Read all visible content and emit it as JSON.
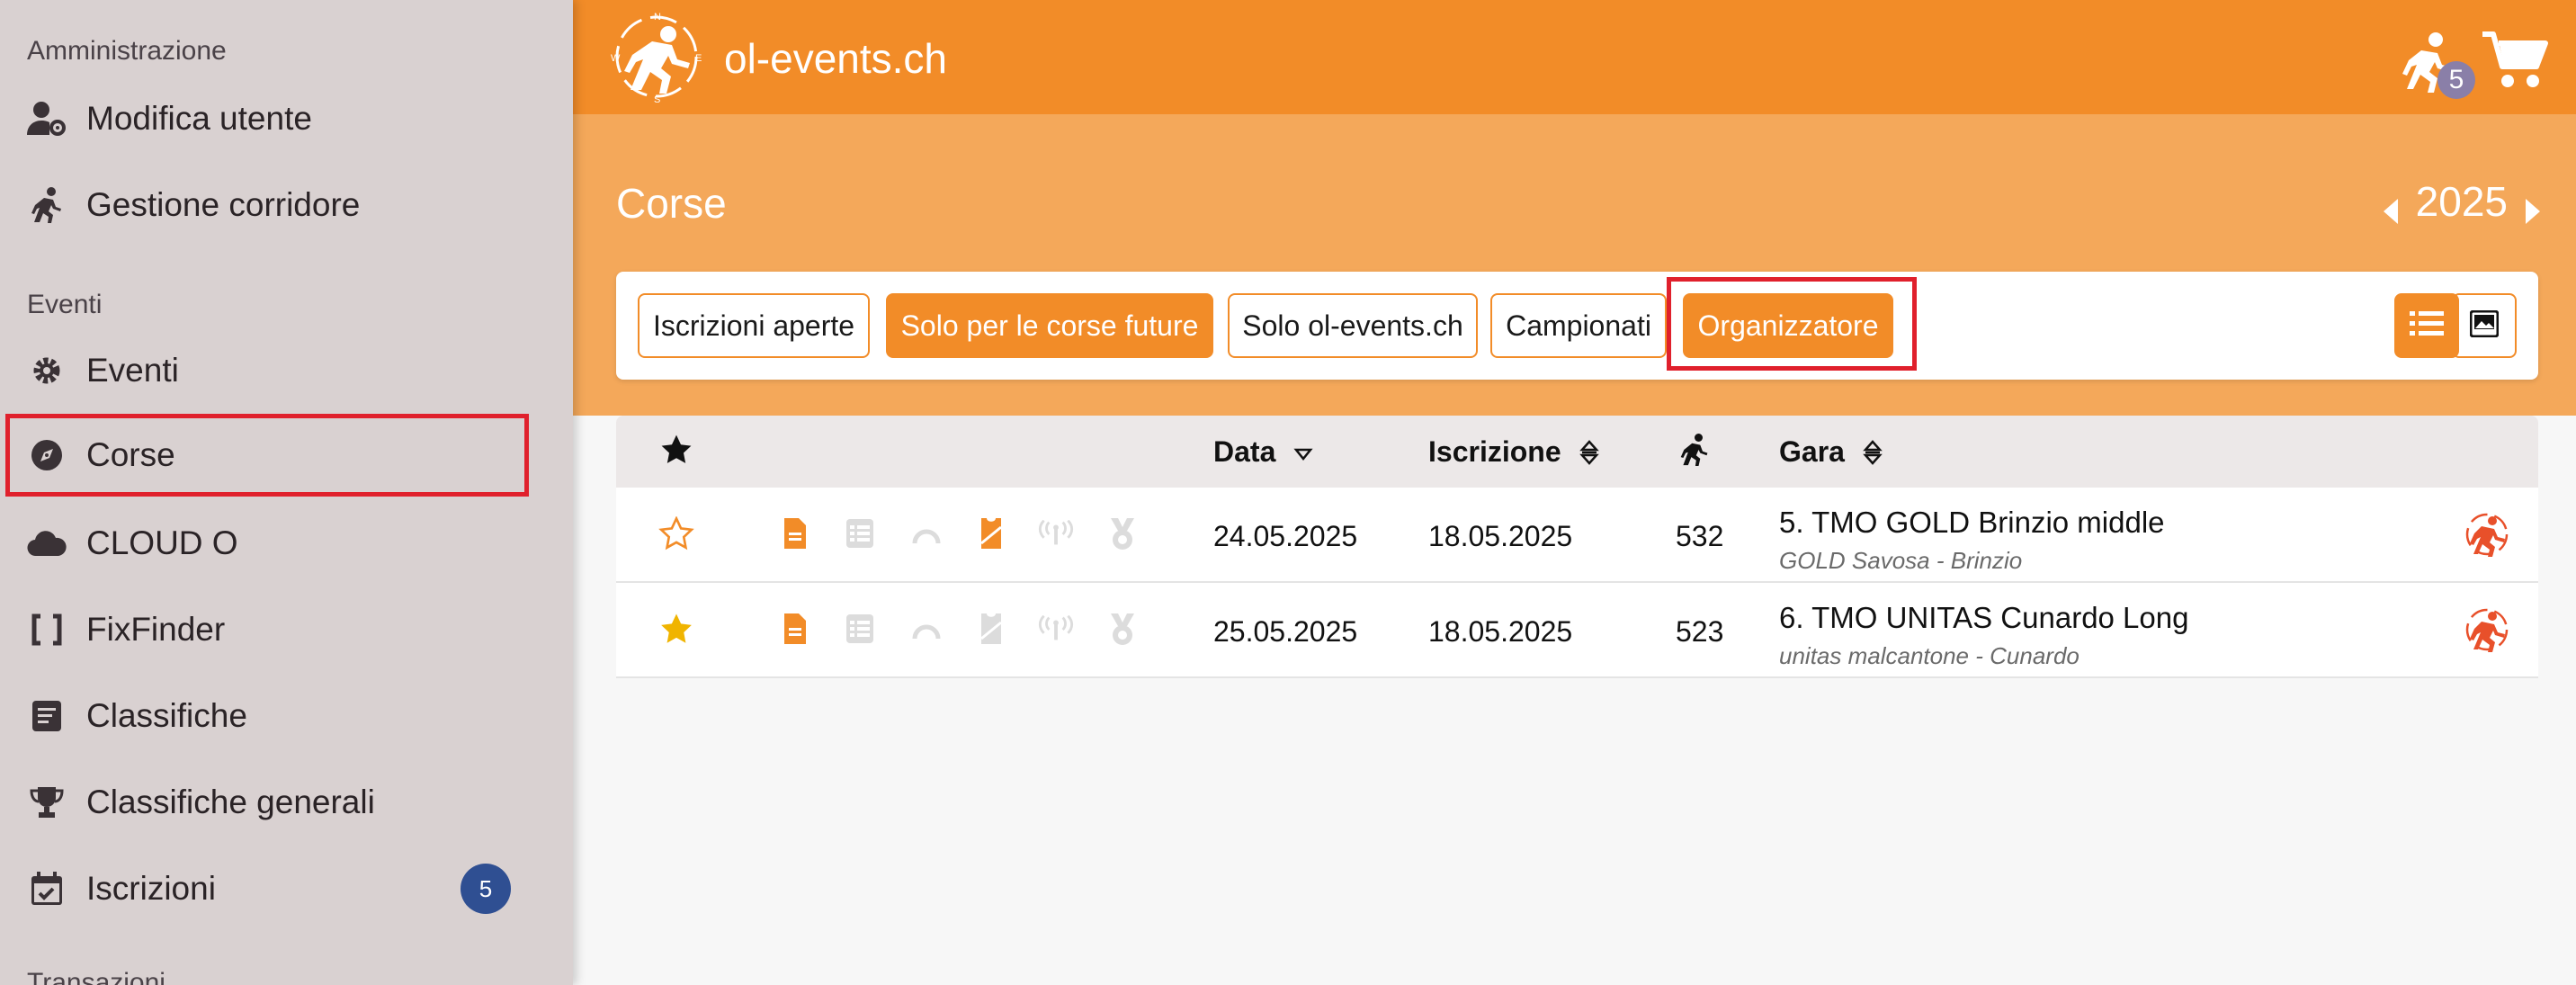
{
  "sidebar": {
    "section_admin": "Amministrazione",
    "section_events": "Eventi",
    "section_transactions": "Transazioni",
    "items": [
      {
        "label": "Modifica utente",
        "icon": "user-gear-icon"
      },
      {
        "label": "Gestione corridore",
        "icon": "runner-icon"
      },
      {
        "label": "Eventi",
        "icon": "gear-icon"
      },
      {
        "label": "Corse",
        "icon": "compass-icon"
      },
      {
        "label": "CLOUD O",
        "icon": "cloud-icon"
      },
      {
        "label": "FixFinder",
        "icon": "brackets-icon"
      },
      {
        "label": "Classifiche",
        "icon": "list-box-icon"
      },
      {
        "label": "Classifiche generali",
        "icon": "trophy-icon"
      },
      {
        "label": "Iscrizioni",
        "icon": "calendar-check-icon",
        "badge": "5"
      }
    ]
  },
  "header": {
    "brand": "ol-events.ch",
    "runner_badge": "5"
  },
  "page": {
    "title": "Corse",
    "year": "2025"
  },
  "filters": [
    {
      "label": "Iscrizioni aperte",
      "active": false
    },
    {
      "label": "Solo per le corse future",
      "active": true
    },
    {
      "label": "Solo ol-events.ch",
      "active": false
    },
    {
      "label": "Campionati",
      "active": false
    },
    {
      "label": "Organizzatore",
      "active": true
    }
  ],
  "table": {
    "headers": {
      "date": "Data",
      "registration": "Iscrizione",
      "race": "Gara"
    },
    "rows": [
      {
        "favorite": false,
        "date": "24.05.2025",
        "registration": "18.05.2025",
        "count": "532",
        "name": "5. TMO GOLD Brinzio middle",
        "sub": "GOLD Savosa - Brinzio",
        "bib_active": true
      },
      {
        "favorite": true,
        "date": "25.05.2025",
        "registration": "18.05.2025",
        "count": "523",
        "name": "6. TMO UNITAS Cunardo Long",
        "sub": "unitas malcantone - Cunardo",
        "bib_active": false
      }
    ]
  },
  "colors": {
    "accent": "#f28c28",
    "band": "#f4a85a",
    "sidebar": "#d9d1d1",
    "highlight": "#e0202c",
    "star": "#f0b400"
  }
}
